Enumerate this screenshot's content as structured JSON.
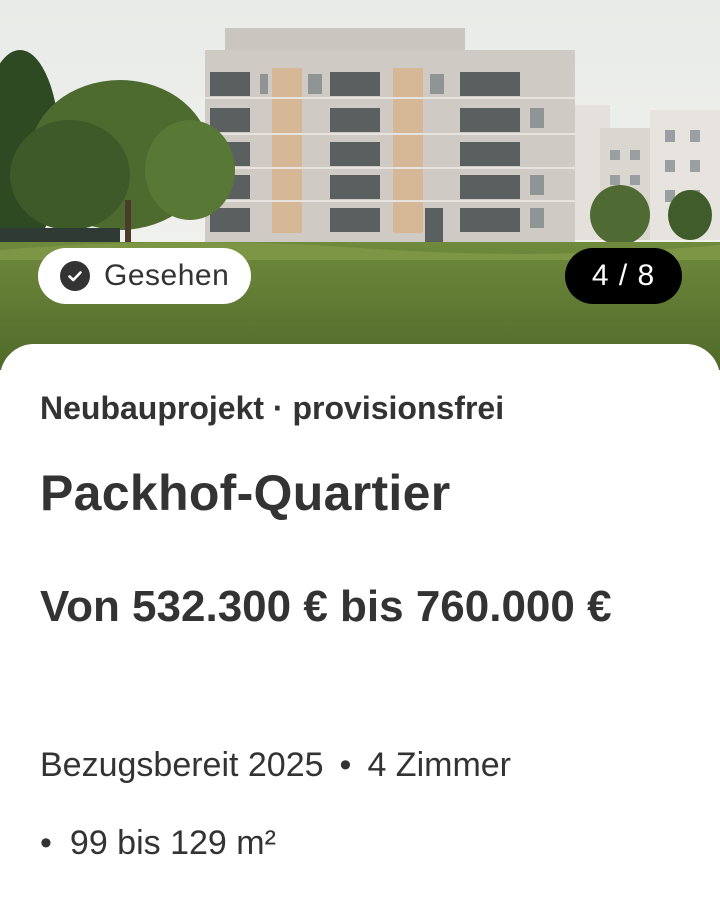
{
  "listing": {
    "seen_label": "Gesehen",
    "image_counter": "4 / 8",
    "project_type": "Neubauprojekt · provisionsfrei",
    "title": "Packhof-Quartier",
    "price": "Von 532.300 € bis 760.000 €",
    "details": {
      "availability": "Bezugsbereit 2025",
      "separator": "•",
      "rooms": "4 Zimmer",
      "area": "99 bis 129 m²"
    }
  },
  "icons": {
    "seen": "check-circle-icon"
  },
  "colors": {
    "text": "#333333",
    "pill_bg": "#ffffff",
    "counter_bg": "#000000",
    "counter_text": "#ffffff"
  }
}
